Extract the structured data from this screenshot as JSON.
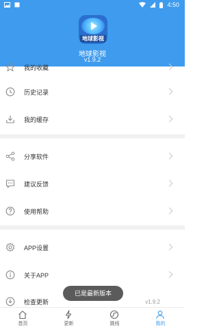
{
  "status_bar": {
    "time": "4:50"
  },
  "app": {
    "name": "地球影视",
    "version": "v1.9.2",
    "logo_text": "地球影视"
  },
  "menu": {
    "partial_top_label": "我的收藏",
    "history": "历史记录",
    "cache": "我的缓存",
    "share": "分享软件",
    "feedback": "建议反馈",
    "help": "使用帮助",
    "app_settings": "APP设置",
    "about": "关于APP",
    "check_update": "检查更新",
    "check_update_version": "v1.9.2"
  },
  "toast": "已是最新版本",
  "tabbar": {
    "home": "首页",
    "update": "更新",
    "jump": "跳线",
    "mine": "我的"
  },
  "colors": {
    "accent": "#3e9bee",
    "icon_gray": "#8a8a8a"
  }
}
